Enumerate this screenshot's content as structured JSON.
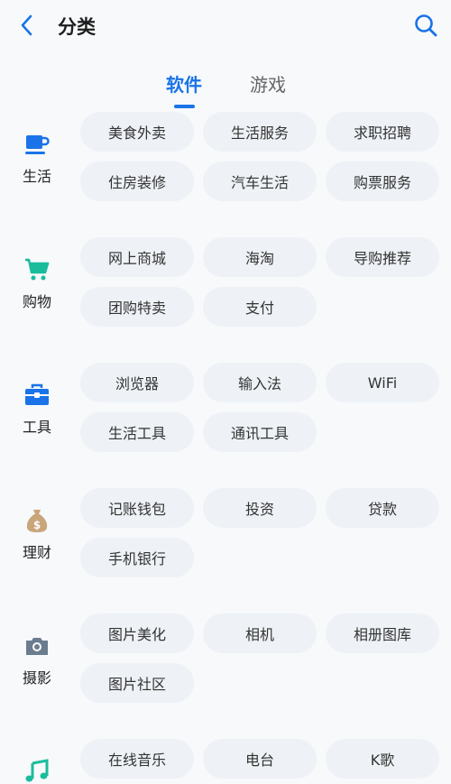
{
  "header": {
    "title": "分类"
  },
  "tabs": [
    {
      "label": "软件"
    },
    {
      "label": "游戏"
    }
  ],
  "colors": {
    "accent": "#1a73e8",
    "chip_bg": "#eef2f6",
    "finance_icon": "#c9a57a",
    "camera_icon": "#6b7c8f",
    "music_icon": "#1abc9c"
  },
  "sections": [
    {
      "label": "生活",
      "icon": "coffee-cup-icon",
      "items": [
        "美食外卖",
        "生活服务",
        "求职招聘",
        "住房装修",
        "汽车生活",
        "购票服务"
      ]
    },
    {
      "label": "购物",
      "icon": "shopping-cart-icon",
      "items": [
        "网上商城",
        "海淘",
        "导购推荐",
        "团购特卖",
        "支付"
      ]
    },
    {
      "label": "工具",
      "icon": "toolbox-icon",
      "items": [
        "浏览器",
        "输入法",
        "WiFi",
        "生活工具",
        "通讯工具"
      ]
    },
    {
      "label": "理财",
      "icon": "money-bag-icon",
      "items": [
        "记账钱包",
        "投资",
        "贷款",
        "手机银行"
      ]
    },
    {
      "label": "摄影",
      "icon": "camera-icon",
      "items": [
        "图片美化",
        "相机",
        "相册图库",
        "图片社区"
      ]
    },
    {
      "label": "",
      "icon": "music-note-icon",
      "items": [
        "在线音乐",
        "电台",
        "K歌"
      ]
    }
  ]
}
